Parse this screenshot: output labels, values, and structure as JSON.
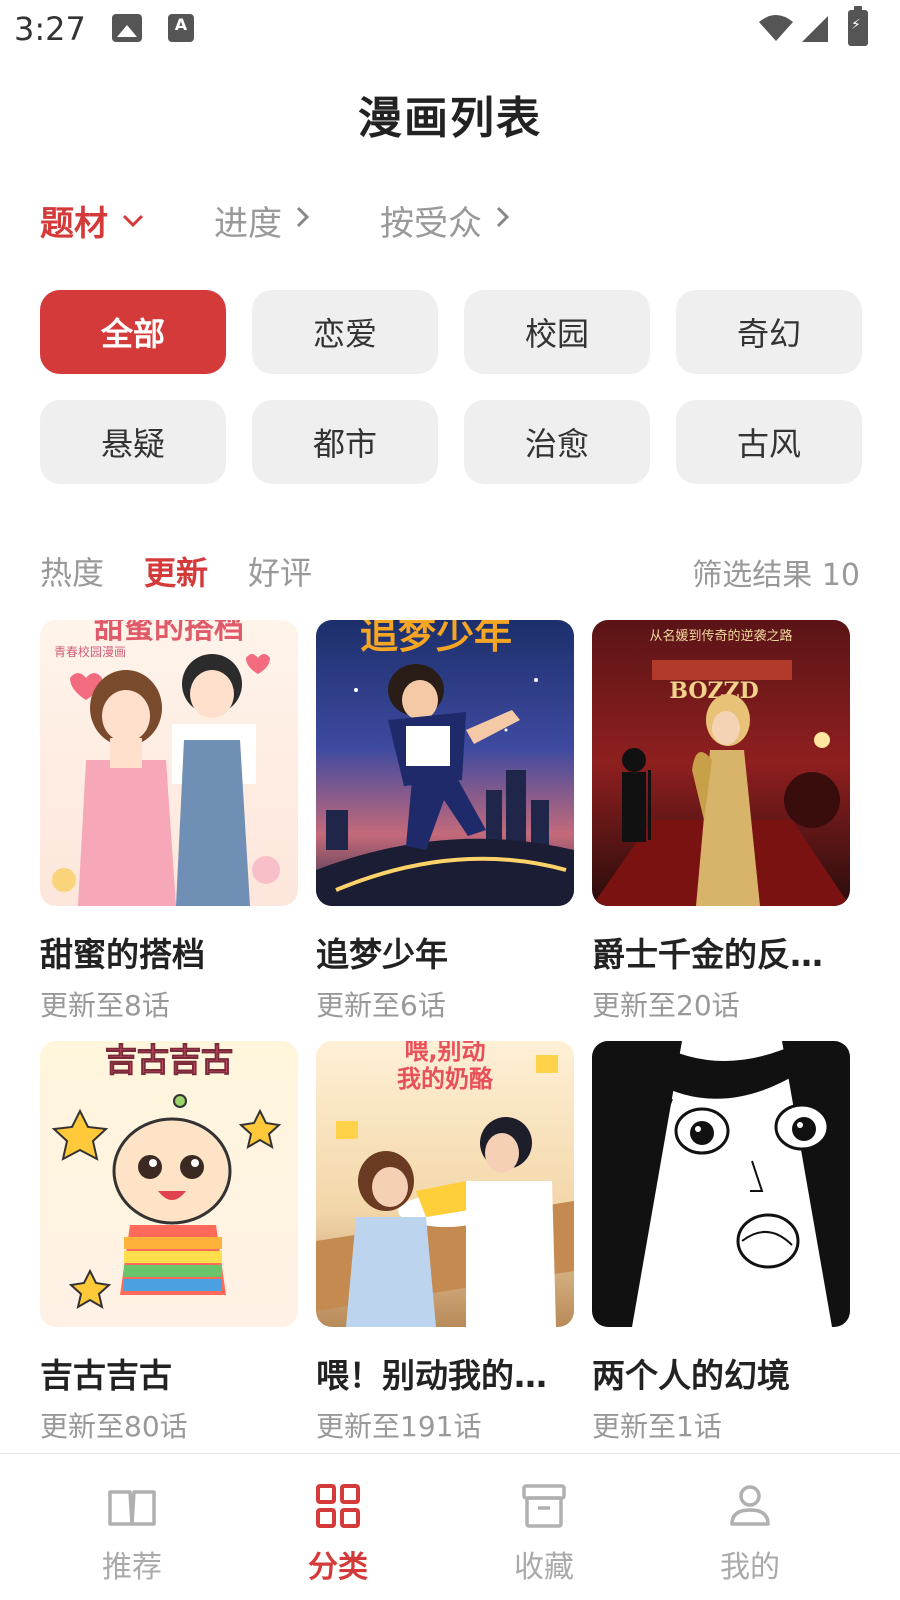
{
  "status_bar": {
    "time": "3:27",
    "a_icon_letter": "A"
  },
  "title": "漫画列表",
  "filters": [
    {
      "label": "题材",
      "chevron": "⌄"
    },
    {
      "label": "进度",
      "chevron": "›"
    },
    {
      "label": "按受众",
      "chevron": "›"
    }
  ],
  "chips": [
    {
      "label": "全部"
    },
    {
      "label": "恋爱"
    },
    {
      "label": "校园"
    },
    {
      "label": "奇幻"
    },
    {
      "label": "悬疑"
    },
    {
      "label": "都市"
    },
    {
      "label": "治愈"
    },
    {
      "label": "古风"
    }
  ],
  "sort_tabs": [
    {
      "label": "热度"
    },
    {
      "label": "更新"
    },
    {
      "label": "好评"
    }
  ],
  "result_count": "筛选结果 10",
  "comics": [
    {
      "title": "甜蜜的搭档",
      "update": "更新至8话",
      "cover_text": "甜蜜的搭档",
      "cover_sub": "青春校园漫画"
    },
    {
      "title": "追梦少年",
      "update": "更新至6话",
      "cover_text": "追梦少年"
    },
    {
      "title": "爵士千金的反…",
      "update": "更新至20话",
      "cover_text": "从名媛到传奇的逆袭之路",
      "cover_sub": "BOZZD"
    },
    {
      "title": "吉古吉古",
      "update": "更新至80话",
      "cover_text": "吉古吉古"
    },
    {
      "title": "喂！别动我的…",
      "update": "更新至191话",
      "cover_text": "喂,别动\n我的奶酪"
    },
    {
      "title": "两个人的幻境",
      "update": "更新至1话"
    }
  ],
  "nav": [
    {
      "label": "推荐",
      "icon": "book-icon"
    },
    {
      "label": "分类",
      "icon": "grid-icon"
    },
    {
      "label": "收藏",
      "icon": "archive-icon"
    },
    {
      "label": "我的",
      "icon": "person-icon"
    }
  ],
  "colors": {
    "accent": "#d43a3a",
    "chip_bg": "#efefef",
    "muted": "#999999"
  }
}
